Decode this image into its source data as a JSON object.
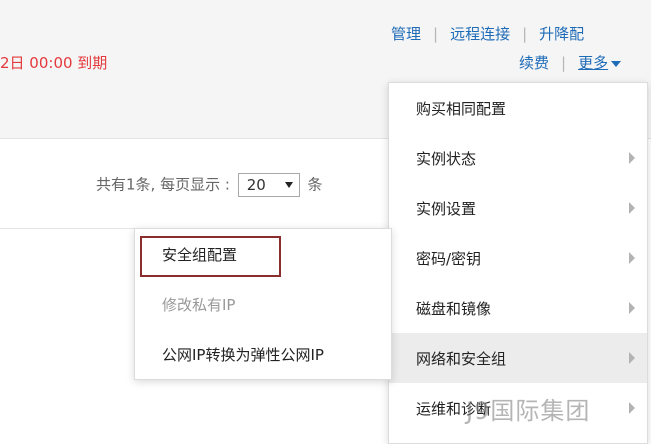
{
  "header": {
    "expiry_text": "2日 00:00 到期",
    "actions_row1": [
      "管理",
      "远程连接",
      "升降配"
    ],
    "renew_label": "续费",
    "more_label": "更多"
  },
  "pager": {
    "summary": "共有1条, 每页显示 :",
    "page_size": "20",
    "unit": "条"
  },
  "menu": {
    "items": [
      {
        "label": "购买相同配置",
        "has_submenu": false
      },
      {
        "label": "实例状态",
        "has_submenu": true
      },
      {
        "label": "实例设置",
        "has_submenu": true
      },
      {
        "label": "密码/密钥",
        "has_submenu": true
      },
      {
        "label": "磁盘和镜像",
        "has_submenu": true
      },
      {
        "label": "网络和安全组",
        "has_submenu": true,
        "active": true
      },
      {
        "label": "运维和诊断",
        "has_submenu": true
      }
    ]
  },
  "submenu": {
    "items": [
      {
        "label": "安全组配置",
        "highlighted": true
      },
      {
        "label": "修改私有IP",
        "disabled": true
      },
      {
        "label": "公网IP转换为弹性公网IP"
      }
    ]
  },
  "watermark": "J9国际集团",
  "colors": {
    "link": "#1e6bb8",
    "expiry": "#e4393c",
    "highlight_border": "#8b2d2d"
  }
}
